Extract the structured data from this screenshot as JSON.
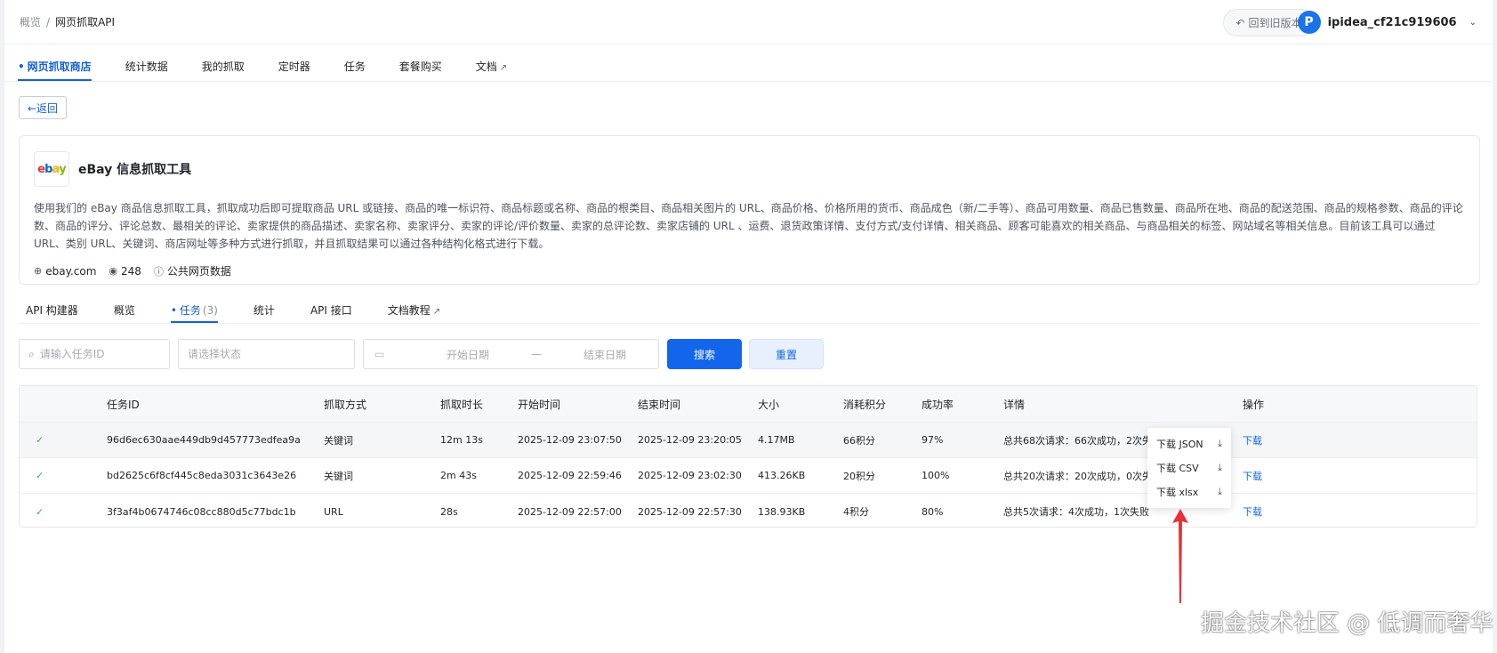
{
  "breadcrumb": {
    "prev": "概览",
    "sep": "/",
    "current": "网页抓取API"
  },
  "header": {
    "old_version": "回到旧版本",
    "username": "ipidea_cf21c919606",
    "avatar_letter": "P"
  },
  "main_tabs": [
    {
      "label": "网页抓取商店",
      "active": true
    },
    {
      "label": "统计数据"
    },
    {
      "label": "我的抓取"
    },
    {
      "label": "定时器"
    },
    {
      "label": "任务"
    },
    {
      "label": "套餐购买"
    },
    {
      "label": "文档"
    }
  ],
  "back_label": "←返回",
  "tool": {
    "logo": {
      "e": "e",
      "b": "b",
      "a": "a",
      "y": "y"
    },
    "title": "eBay 信息抓取工具",
    "description": "使用我们的 eBay 商品信息抓取工具，抓取成功后即可提取商品 URL 或链接、商品的唯一标识符、商品标题或名称、商品的根类目、商品相关图片的 URL、商品价格、价格所用的货币、商品成色（新/二手等）、商品可用数量、商品已售数量、商品所在地、商品的配送范围、商品的规格参数、商品的评论数、商品的评分、评论总数、最相关的评论、卖家提供的商品描述、卖家名称、卖家评分、卖家的评论/评价数量、卖家的总评论数、卖家店铺的 URL 、运费、退货政策详情、支付方式/支付详情、相关商品、顾客可能喜欢的相关商品、与商品相关的标签、网站域名等相关信息。目前该工具可以通过 URL、类别 URL、关键词、商店网址等多种方式进行抓取，并且抓取结果可以通过各种结构化格式进行下载。",
    "domain": "ebay.com",
    "views": "248",
    "data_type": "公共网页数据"
  },
  "sub_tabs": [
    {
      "label": "API 构建器"
    },
    {
      "label": "概览"
    },
    {
      "label": "任务",
      "count": "(3)",
      "active": true
    },
    {
      "label": "统计"
    },
    {
      "label": "API 接口"
    },
    {
      "label": "文档教程"
    }
  ],
  "filters": {
    "task_id_placeholder": "请输入任务ID",
    "status_placeholder": "请选择状态",
    "start_date": "开始日期",
    "date_sep": "—",
    "end_date": "结束日期",
    "search": "搜索",
    "reset": "重置"
  },
  "table": {
    "headers": {
      "id": "任务ID",
      "mode": "抓取方式",
      "duration": "抓取时长",
      "start": "开始时间",
      "end": "结束时间",
      "size": "大小",
      "points": "消耗积分",
      "rate": "成功率",
      "detail": "详情",
      "op": "操作"
    },
    "rows": [
      {
        "id": "96d6ec630aae449db9d457773edfea9a",
        "mode": "关键词",
        "duration": "12m 13s",
        "start": "2025-12-09 23:07:50",
        "end": "2025-12-09 23:20:05",
        "size": "4.17MB",
        "points": "66积分",
        "rate": "97%",
        "detail": "总共68次请求：66次成功，2次失",
        "op": "下载"
      },
      {
        "id": "bd2625c6f8cf445c8eda3031c3643e26",
        "mode": "关键词",
        "duration": "2m 43s",
        "start": "2025-12-09 22:59:46",
        "end": "2025-12-09 23:02:30",
        "size": "413.26KB",
        "points": "20积分",
        "rate": "100%",
        "detail": "总共20次请求：20次成功，0次失",
        "op": "下载"
      },
      {
        "id": "3f3af4b0674746c08cc880d5c77bdc1b",
        "mode": "URL",
        "duration": "28s",
        "start": "2025-12-09 22:57:00",
        "end": "2025-12-09 22:57:30",
        "size": "138.93KB",
        "points": "4积分",
        "rate": "80%",
        "detail": "总共5次请求：4次成功，1次失败",
        "op": "下载"
      }
    ]
  },
  "download_menu": [
    {
      "label": "下载 JSON"
    },
    {
      "label": "下载 CSV"
    },
    {
      "label": "下载 xlsx"
    }
  ],
  "icons": {
    "check": "✓",
    "download": "⤓",
    "external": "↗",
    "globe": "⊕",
    "eye": "◉",
    "info": "ⓘ",
    "search": "⌕",
    "calendar": "▭",
    "undo": "↶",
    "chevron": "⌄"
  },
  "watermark": "掘金技术社区 @ 低调而奢华",
  "colors": {
    "accent": "#1366ec",
    "success": "#2fae66",
    "arrow": "#e53238"
  }
}
